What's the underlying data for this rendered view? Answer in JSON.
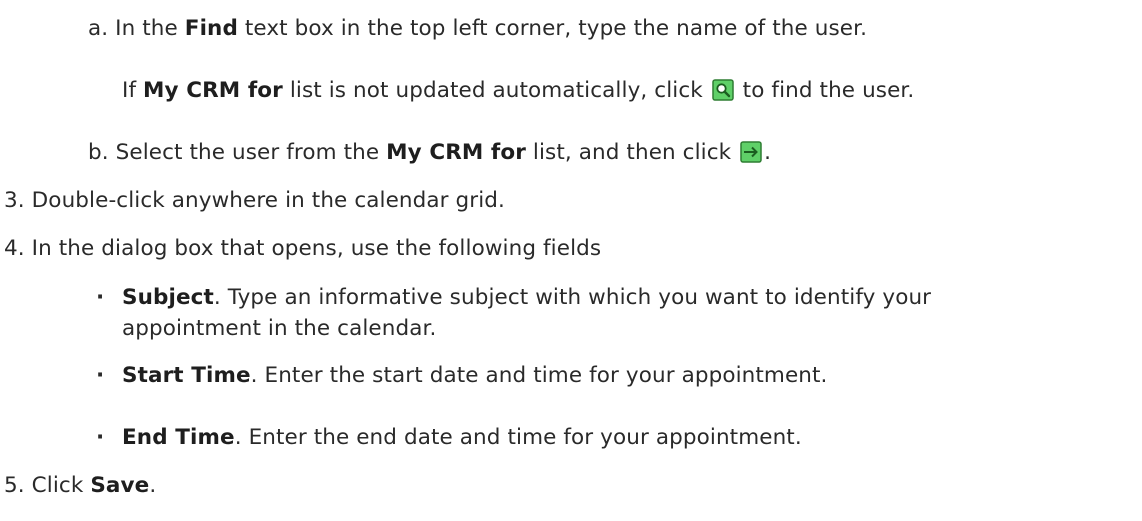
{
  "step_a": {
    "marker": "a.",
    "pre": "In the ",
    "bold": "Find",
    "post": " text box in the top left corner, type the name of the user."
  },
  "step_a_note": {
    "pre": "If ",
    "bold": "My CRM for",
    "mid": " list is not updated automatically, click ",
    "post": " to find the user.",
    "icon": "search-icon"
  },
  "step_b": {
    "marker": "b.",
    "pre": "Select the user from the ",
    "bold": "My CRM for",
    "mid": " list, and then click ",
    "post": ".",
    "icon": "arrow-right-icon"
  },
  "step_3": {
    "marker": "3.",
    "text": "Double-click anywhere in the calendar grid."
  },
  "step_4": {
    "marker": "4.",
    "text": "In the dialog box that opens, use the following fields"
  },
  "fields": [
    {
      "bullet": "·",
      "name": "Subject",
      "line1": ". Type an informative subject with which you want to identify your",
      "line2": "appointment in the calendar."
    },
    {
      "bullet": "·",
      "name": "Start Time",
      "line1": ". Enter the start date and time for your appointment."
    },
    {
      "bullet": "·",
      "name": "End Time",
      "line1": ". Enter the end date and time for your appointment."
    }
  ],
  "step_5": {
    "marker": "5.",
    "pre": "Click ",
    "bold": "Save",
    "post": "."
  },
  "colors": {
    "icon_fill": "#5fd068",
    "icon_stroke": "#2e7d32"
  }
}
